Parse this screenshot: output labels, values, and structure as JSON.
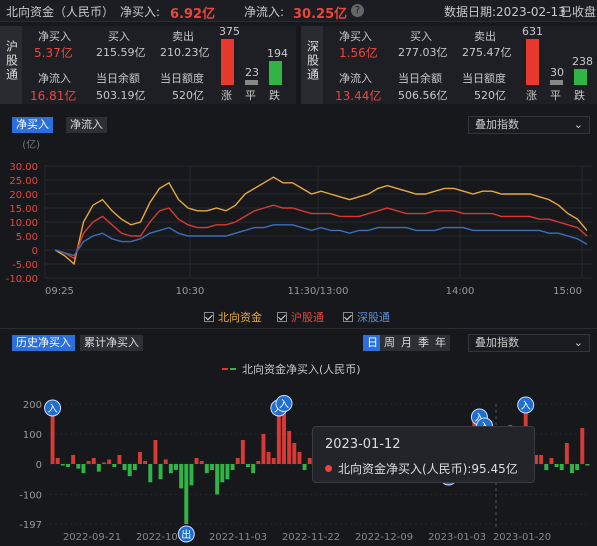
{
  "header": {
    "title": "北向资金（人民币）",
    "net_buy_label": "净买入:",
    "net_buy_value": "6.92亿",
    "net_inflow_label": "净流入:",
    "net_inflow_value": "30.25亿",
    "help_icon": "question-icon",
    "date_label": "数据日期:2023-02-13",
    "status": "已收盘"
  },
  "sh": {
    "name": "沪股通",
    "net_buy_label": "净买入",
    "net_buy": "5.37亿",
    "buy_label": "买入",
    "buy": "215.59亿",
    "sell_label": "卖出",
    "sell": "210.23亿",
    "net_inflow_label": "净流入",
    "net_inflow": "16.81亿",
    "balance_label": "当日余额",
    "balance": "503.19亿",
    "quota_label": "当日额度",
    "quota": "520亿",
    "up": "375",
    "flat": "23",
    "down": "194",
    "up_label": "涨",
    "flat_label": "平",
    "down_label": "跌"
  },
  "sz": {
    "name": "深股通",
    "net_buy_label": "净买入",
    "net_buy": "1.56亿",
    "buy_label": "买入",
    "buy": "277.03亿",
    "sell_label": "卖出",
    "sell": "275.47亿",
    "net_inflow_label": "净流入",
    "net_inflow": "13.44亿",
    "balance_label": "当日余额",
    "balance": "506.56亿",
    "quota_label": "当日额度",
    "quota": "520亿",
    "up": "631",
    "flat": "30",
    "down": "238",
    "up_label": "涨",
    "flat_label": "平",
    "down_label": "跌"
  },
  "tabs1": [
    "净买入",
    "净流入"
  ],
  "overlay1": "叠加指数",
  "tabs2": [
    "历史净买入",
    "累计净买入"
  ],
  "period_tabs": [
    "日",
    "周",
    "月",
    "季",
    "年"
  ],
  "overlay2": "叠加指数",
  "colors": {
    "north": "#e8a93b",
    "sh": "#d63a35",
    "sz": "#3c6fb6",
    "up": "#d63a35",
    "down": "#2fb445"
  },
  "chart_data": [
    {
      "type": "line",
      "ylabel": "(亿)",
      "ylim": [
        -10,
        30
      ],
      "yticks": [
        "30.00",
        "25.00",
        "20.00",
        "15.00",
        "10.00",
        "5.00",
        "0",
        "-5.00",
        "-10.00"
      ],
      "xticks": [
        "09:25",
        "10:30",
        "11:30/13:00",
        "14:00",
        "15:00"
      ],
      "series": [
        {
          "name": "北向资金",
          "values": [
            0,
            -2,
            -5,
            10,
            16,
            18,
            14,
            11,
            9,
            10,
            17,
            22,
            24,
            18,
            15,
            14,
            14,
            15,
            14,
            16,
            20,
            22,
            24,
            26,
            24,
            24,
            22,
            20,
            21,
            20,
            19,
            18,
            19,
            20,
            22,
            23,
            22,
            21,
            20,
            20,
            21,
            22,
            22,
            21,
            20,
            21,
            21,
            20,
            20,
            20,
            20,
            19,
            18,
            16,
            13,
            11,
            7
          ]
        },
        {
          "name": "沪股通",
          "values": [
            0,
            -1,
            -3,
            6,
            10,
            12,
            9,
            6,
            5,
            5,
            10,
            14,
            15,
            11,
            9,
            8,
            8,
            9,
            9,
            10,
            12,
            14,
            15,
            16,
            15,
            15,
            14,
            13,
            13,
            13,
            12,
            12,
            12,
            13,
            14,
            15,
            14,
            13,
            13,
            13,
            14,
            14,
            14,
            13,
            13,
            13,
            13,
            12,
            12,
            12,
            12,
            11,
            11,
            10,
            9,
            8,
            5
          ]
        },
        {
          "name": "深股通",
          "values": [
            0,
            -1,
            -2,
            3,
            5,
            6,
            4,
            3,
            3,
            4,
            6,
            7,
            8,
            6,
            5,
            5,
            5,
            5,
            5,
            6,
            7,
            8,
            8,
            9,
            9,
            9,
            8,
            7,
            8,
            7,
            7,
            6,
            7,
            7,
            8,
            8,
            8,
            8,
            7,
            7,
            7,
            8,
            8,
            8,
            7,
            7,
            7,
            7,
            7,
            7,
            7,
            7,
            6,
            6,
            5,
            4,
            2
          ]
        }
      ]
    },
    {
      "type": "bar",
      "title": "北向资金净买入(人民币)",
      "yticks": [
        "200",
        "100",
        "0",
        "-100",
        "-197"
      ],
      "ylim": [
        -197,
        200
      ],
      "xticks": [
        "2022-09-21",
        "2022-10-17",
        "2022-11-03",
        "2022-11-22",
        "2022-12-09",
        "2023-01-03",
        "2023-01-20"
      ],
      "values": [
        160,
        20,
        -5,
        -10,
        30,
        -15,
        -30,
        10,
        20,
        -25,
        5,
        15,
        -10,
        30,
        -20,
        -40,
        -20,
        40,
        10,
        -60,
        80,
        -50,
        15,
        -30,
        -20,
        -80,
        -197,
        -70,
        20,
        10,
        -30,
        -20,
        -100,
        -60,
        -50,
        -20,
        20,
        80,
        -10,
        -30,
        10,
        100,
        40,
        20,
        160,
        175,
        110,
        70,
        40,
        -20,
        20,
        25,
        15,
        40,
        -20,
        10,
        30,
        -30,
        -10,
        40,
        20,
        15,
        -40,
        30,
        15,
        20,
        -20,
        40,
        10,
        30,
        20,
        50,
        80,
        60,
        40,
        80,
        30,
        -10,
        70,
        40,
        20,
        95,
        140,
        130,
        100,
        90,
        -20,
        60,
        120,
        130,
        50,
        100,
        170,
        70,
        30,
        30,
        -20,
        20,
        -10,
        -20,
        70,
        -30,
        -20,
        120,
        -5
      ],
      "markers": [
        {
          "label": "入",
          "index": 0
        },
        {
          "label": "出",
          "index": 26
        },
        {
          "label": "入",
          "index": 44
        },
        {
          "label": "入",
          "index": 45
        },
        {
          "label": "入",
          "index": 77
        },
        {
          "label": "入",
          "index": 83
        },
        {
          "label": "入",
          "index": 84
        },
        {
          "label": "入",
          "index": 92
        }
      ],
      "tooltip": {
        "date": "2023-01-12",
        "label": "北向资金净买入(人民币):95.45亿"
      }
    }
  ]
}
